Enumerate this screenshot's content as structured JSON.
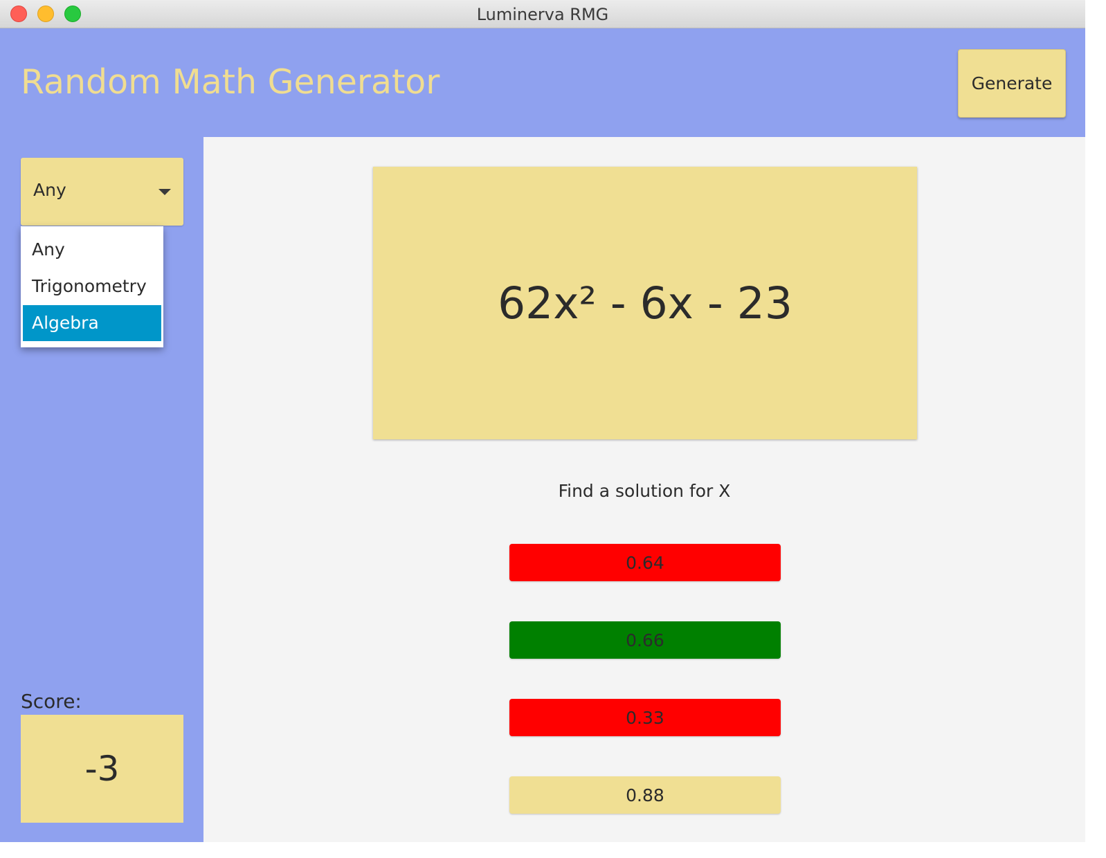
{
  "window": {
    "title": "Luminerva RMG"
  },
  "header": {
    "title": "Random Math Generator",
    "generate_label": "Generate"
  },
  "category": {
    "selected": "Any",
    "options": [
      {
        "label": "Any",
        "highlighted": false
      },
      {
        "label": "Trigonometry",
        "highlighted": false
      },
      {
        "label": "Algebra",
        "highlighted": true
      }
    ]
  },
  "score": {
    "label": "Score:",
    "value": "-3"
  },
  "question": {
    "expression": "62x² - 6x - 23",
    "instruction": "Find a solution for X"
  },
  "answers": [
    {
      "label": "0.64",
      "state": "wrong",
      "color": "#ff0000"
    },
    {
      "label": "0.66",
      "state": "correct",
      "color": "#008000"
    },
    {
      "label": "0.33",
      "state": "wrong",
      "color": "#ff0000"
    },
    {
      "label": "0.88",
      "state": "unanswered",
      "color": "#f0df93"
    }
  ],
  "colors": {
    "app_background": "#8fa1ef",
    "accent_yellow": "#f0df93",
    "content_background": "#f4f4f4",
    "selection_blue": "#0096c9"
  }
}
